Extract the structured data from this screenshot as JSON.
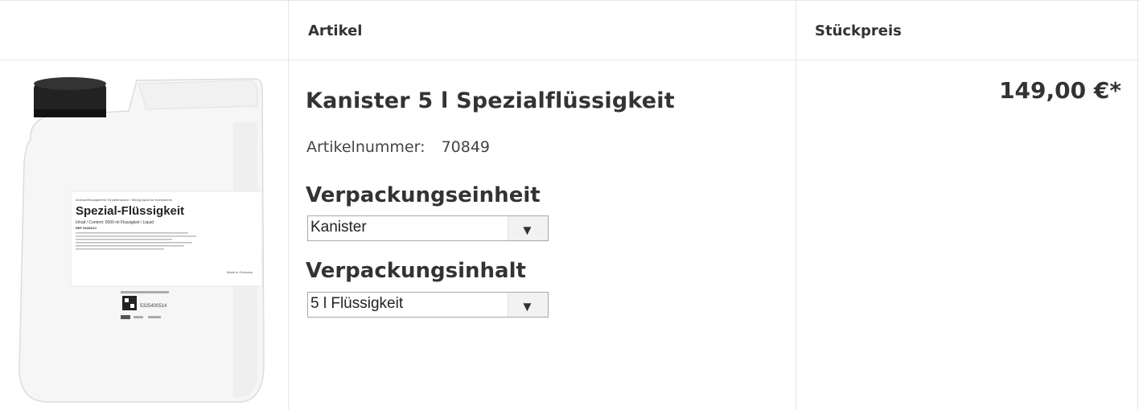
{
  "table": {
    "col_article": "Artikel",
    "col_unit_price": "Stückpreis"
  },
  "product": {
    "title": "Kanister 5 l Spezialflüssigkeit",
    "article_number_label": "Artikelnummer:",
    "article_number": "70849",
    "price": "149,00 €*",
    "image": {
      "label_small_top": "Anmischflüssigkeit für Einbettmassen / Mixing liquid for investments",
      "label_title": "Spezial-Flüssigkeit",
      "label_content": "Inhalt / Content: 5000 ml Flüssigkeit / Liquid",
      "label_ref": "REF 5340/014",
      "label_made_in": "Made in Germany",
      "label_barcode_number": "5325400514"
    }
  },
  "options": {
    "packaging_unit": {
      "heading": "Verpackungseinheit",
      "selected": "Kanister"
    },
    "packaging_content": {
      "heading": "Verpackungsinhalt",
      "selected": "5 l Flüssigkeit"
    }
  },
  "icons": {
    "dropdown": "triangle-down-icon"
  }
}
